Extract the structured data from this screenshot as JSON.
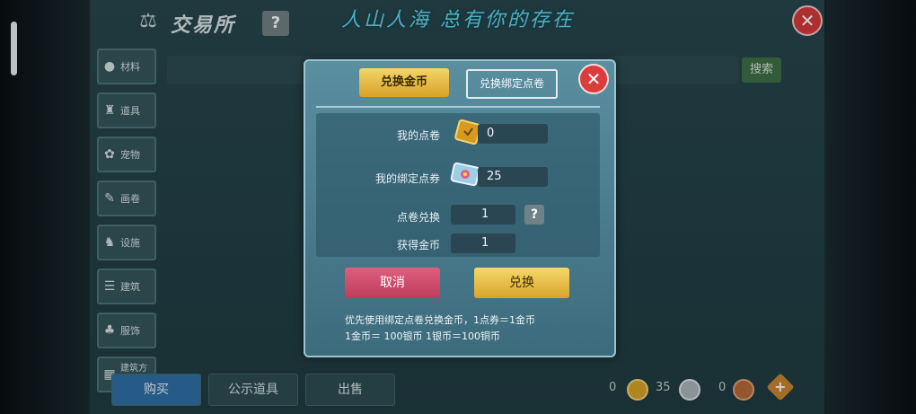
{
  "header": {
    "title": "交易所",
    "help_label": "?",
    "slogan": "人山人海 总有你的存在",
    "close_label": "✕"
  },
  "sidebar": {
    "items": [
      {
        "label": "材料",
        "icon": "ore-icon"
      },
      {
        "label": "道具",
        "icon": "potion-icon"
      },
      {
        "label": "宠物",
        "icon": "paw-icon"
      },
      {
        "label": "画卷",
        "icon": "scroll-icon"
      },
      {
        "label": "设施",
        "icon": "facility-icon"
      },
      {
        "label": "建筑",
        "icon": "building-icon"
      },
      {
        "label": "服饰",
        "icon": "clothing-icon"
      },
      {
        "label": "建筑方案图纸",
        "icon": "blueprint-icon"
      }
    ]
  },
  "search": {
    "button_label": "搜索"
  },
  "bottom": {
    "tabs": [
      "购买",
      "公示道具",
      "出售"
    ],
    "currencies": [
      {
        "amount": "0",
        "color": "#d8a12a"
      },
      {
        "amount": "35",
        "color": "#a8b4ba"
      },
      {
        "amount": "0",
        "color": "#b6683a"
      }
    ],
    "add_label": "+"
  },
  "dialog": {
    "tab_gold": "兑换金币",
    "tab_bound": "兑换绑定点卷",
    "close_label": "✕",
    "my_points_label": "我的点卷",
    "my_points_value": "0",
    "my_bound_label": "我的绑定点券",
    "my_bound_value": "25",
    "exchange_label": "点卷兑换",
    "exchange_value": "1",
    "gain_label": "获得金币",
    "gain_value": "1",
    "help_label": "?",
    "cancel_label": "取消",
    "confirm_label": "兑换",
    "note_line1": "优先使用绑定点卷兑换金币，1点券＝1金币",
    "note_line2": "1金币＝ 100银币  1银币＝100铜币"
  }
}
